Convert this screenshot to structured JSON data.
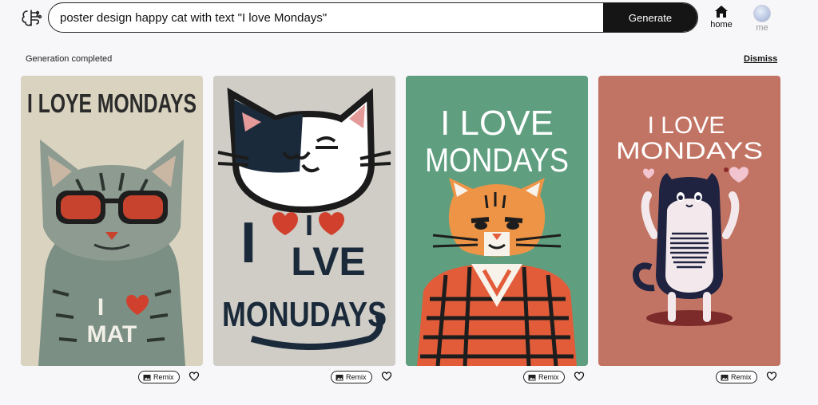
{
  "search": {
    "value": "poster design happy cat with text \"I love Mondays\"",
    "button_label": "Generate"
  },
  "nav": {
    "home_label": "home",
    "me_label": "me"
  },
  "status": {
    "message": "Generation completed",
    "dismiss_label": "Dismiss"
  },
  "results": [
    {
      "poster_text": [
        "I LOYE MONDAYS",
        "I",
        "MAT"
      ],
      "background": "#d9d3c0",
      "remix_label": "Remix"
    },
    {
      "poster_text": [
        "I",
        "I",
        "LVE",
        "MONUDAYS"
      ],
      "background": "#cfcdc6",
      "remix_label": "Remix"
    },
    {
      "poster_text": [
        "I LOVE",
        "MONDAYS"
      ],
      "background": "#5f9f7f",
      "remix_label": "Remix"
    },
    {
      "poster_text": [
        "I LOVE",
        "MONDAYS"
      ],
      "background": "#c27464",
      "remix_label": "Remix"
    }
  ],
  "icons": {
    "logo": "brain-logo-icon",
    "home": "home-icon",
    "remix": "image-remix-icon",
    "like": "heart-outline-icon"
  }
}
